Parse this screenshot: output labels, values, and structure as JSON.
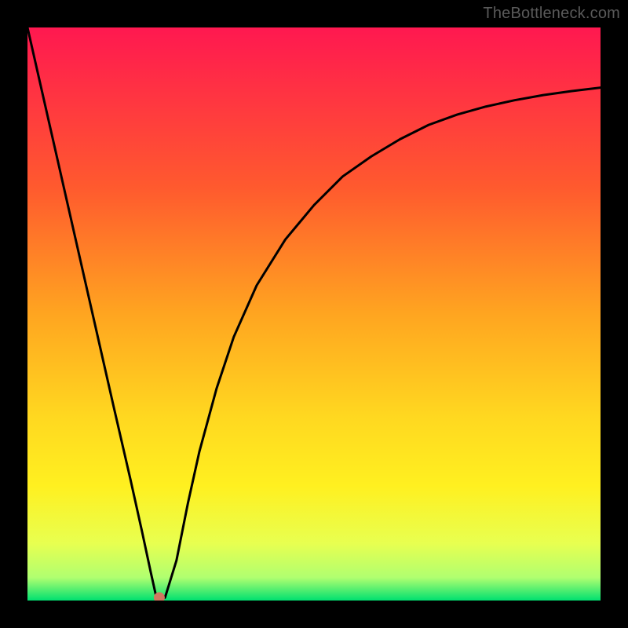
{
  "watermark": "TheBottleneck.com",
  "colors": {
    "bg": "#000000",
    "top": "#ff1850",
    "mid1": "#ff5a2e",
    "mid2": "#ffa520",
    "mid3": "#ffd820",
    "mid4": "#fff020",
    "low1": "#e8ff50",
    "low2": "#b0ff70",
    "bottom": "#00e070",
    "curve": "#000000",
    "dot": "#d07860"
  },
  "chart_data": {
    "type": "line",
    "title": "",
    "xlabel": "",
    "ylabel": "",
    "xlim": [
      0,
      100
    ],
    "ylim": [
      0,
      100
    ],
    "series": [
      {
        "name": "curve",
        "x": [
          0,
          5,
          10,
          15,
          18,
          20,
          21.5,
          22.5,
          24,
          26,
          28,
          30,
          33,
          36,
          40,
          45,
          50,
          55,
          60,
          65,
          70,
          75,
          80,
          85,
          90,
          95,
          100
        ],
        "y": [
          100,
          78,
          56,
          34,
          21,
          12,
          5,
          0.5,
          0.5,
          7,
          17,
          26,
          37,
          46,
          55,
          63,
          69,
          74,
          77.5,
          80.5,
          83,
          84.8,
          86.2,
          87.3,
          88.2,
          88.9,
          89.5
        ]
      }
    ],
    "minimum_point": {
      "x": 23,
      "y": 0.5
    },
    "annotations": []
  }
}
